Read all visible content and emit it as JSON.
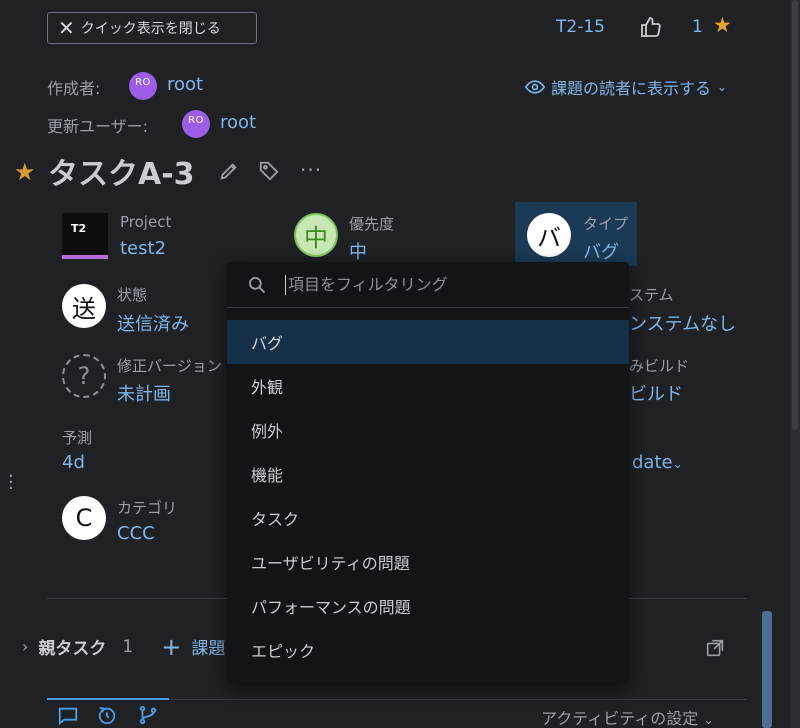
{
  "header": {
    "close_quick_view": "クイック表示を閉じる",
    "issue_key": "T2-15",
    "vote_count": "1"
  },
  "people": {
    "creator_label": "作成者:",
    "creator_avatar": "RO",
    "creator_name": "root",
    "updater_label": "更新ユーザー:",
    "updater_avatar": "RO",
    "updater_name": "root",
    "watch_label": "課題の読者に表示する"
  },
  "title": "タスクA-3",
  "fields": {
    "project": {
      "label": "Project",
      "value": "test2",
      "tile": "T2"
    },
    "priority": {
      "label": "優先度",
      "value": "中",
      "tile": "中"
    },
    "type": {
      "label": "タイプ",
      "value": "バグ",
      "tile": "バ"
    },
    "state": {
      "label": "状態",
      "value": "送信済み",
      "tile": "送"
    },
    "system": {
      "label": "ステム",
      "value": "ンステムなし"
    },
    "fix_version": {
      "label": "修正バージョン",
      "value": "未計画",
      "tile": "?"
    },
    "build": {
      "label": "みビルド",
      "value": "ビルド"
    },
    "estimate": {
      "label": "予測",
      "value": "4d"
    },
    "date": {
      "value": "date"
    },
    "category": {
      "label": "カテゴリ",
      "value": "CCC",
      "tile": "C"
    }
  },
  "parent": {
    "label": "親タスク",
    "count": "1",
    "issue_label": "課題"
  },
  "activity_settings": "アクティビティの設定",
  "dropdown": {
    "placeholder": "項目をフィルタリング",
    "items": [
      "バグ",
      "外観",
      "例外",
      "機能",
      "タスク",
      "ユーザビリティの問題",
      "パフォーマンスの問題",
      "エピック"
    ],
    "selected_index": 0
  }
}
